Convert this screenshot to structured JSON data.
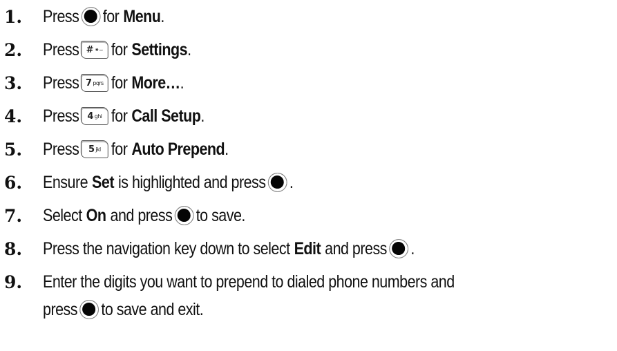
{
  "steps": [
    {
      "num": "1.",
      "pre": "Press",
      "key": "",
      "mid": "for",
      "bold": "Menu",
      "post": "."
    },
    {
      "num": "2.",
      "pre": "Press",
      "key": "#",
      "key_letters": "⁕~",
      "mid": "for",
      "bold": "Settings",
      "post": "."
    },
    {
      "num": "3.",
      "pre": "Press",
      "key": "7",
      "key_letters": "pqrs",
      "mid": "for",
      "bold": "More…",
      "post": "."
    },
    {
      "num": "4.",
      "pre": "Press",
      "key": "4",
      "key_letters": "ghi",
      "mid": "for",
      "bold": "Call Setup",
      "post": "."
    },
    {
      "num": "5.",
      "pre": "Press",
      "key": "5",
      "key_letters": "jkl",
      "mid": "for",
      "bold": "Auto Prepend",
      "post": "."
    },
    {
      "num": "6.",
      "pre": "Ensure",
      "bold": "Set",
      "mid": "is highlighted and press",
      "post": "."
    },
    {
      "num": "7.",
      "pre": "Select",
      "bold": "On",
      "mid": "and press",
      "post": "to save."
    },
    {
      "num": "8.",
      "pre": "Press the navigation key down to select",
      "bold": "Edit",
      "mid": "and press",
      "post": "."
    },
    {
      "num": "9.",
      "line1": "Enter the digits you want to prepend to dialed phone numbers and",
      "pre": "press",
      "post": "to save and exit."
    }
  ]
}
